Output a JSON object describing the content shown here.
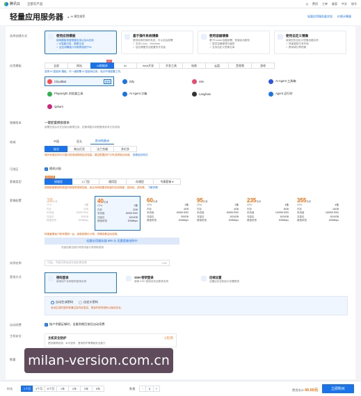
{
  "topbar": {
    "logo_text": "腾讯云",
    "nav_label": "全部云产品",
    "right_items": [
      "Q",
      "费用",
      "工单",
      "备案",
      "中文",
      "账号"
    ]
  },
  "header": {
    "title": "轻量应用服务器",
    "tag_label": "AI 模型推荐",
    "right_links": [
      "轻量应用服务器文档",
      "价格计算器"
    ]
  },
  "scenario": {
    "label": "选择创建方式",
    "cards": [
      {
        "title": "使用应用模板",
        "desc": [
          "使用模板快速搭建应用以及AI应用",
          "✓ AI智能问答、图像生成",
          "✓ 这应用模板计价推荐适用于AI"
        ],
        "selected": true
      },
      {
        "title": "基于操作系统镜像",
        "desc": [
          "提供纯净的操作系统，可以自由部署",
          "✓ 支持 Linux、Windows",
          "✓ 适合需要灵活配置的开发者"
        ],
        "selected": false
      },
      {
        "title": "使用容器镜像",
        "desc": [
          "基于Docker容器部署，快速启动服务",
          "✓ 提供容器管理与编排",
          "✓ 支持自定义镜像仓库"
        ],
        "selected": false
      },
      {
        "title": "使用自定义镜像",
        "desc": [
          "使用您的自定义镜像创建实例",
          "✓ 快速复制已有环境",
          "✓ 跨地域共享镜像"
        ],
        "selected": false
      }
    ]
  },
  "app_template": {
    "label": "应用模板",
    "tabs": [
      "全部",
      "网站",
      "AI智能体",
      "AI",
      "Web开发",
      "开发工具",
      "电商",
      "云盘",
      "音视频",
      "游戏"
    ],
    "active_tab": 2,
    "hot_badge": "HOT",
    "hint": "选择 AI 智能体 模板，可一键部署 AI 智能体应用，免去环境配置工作。",
    "items": [
      {
        "name": "CloudBot",
        "badge": "推荐",
        "color": "#ff4d4f"
      },
      {
        "name": "Dify",
        "badge": "",
        "color": "#1a73e8"
      },
      {
        "name": "n8n",
        "badge": "",
        "color": "#ea4b71"
      },
      {
        "name": "AI Agent 工具箱",
        "badge": "",
        "color": "#2f54eb"
      },
      {
        "name": "Playwright 浏览器工具",
        "badge": "",
        "color": "#2ab44a"
      },
      {
        "name": "AI Agent 沙箱",
        "badge": "",
        "color": "#1a73e8"
      },
      {
        "name": "Langfuse",
        "badge": "",
        "color": "#333333"
      },
      {
        "name": "Agent 运行时",
        "badge": "",
        "color": "#1a73e8"
      },
      {
        "name": "Qdrant",
        "badge": "",
        "color": "#d4237a"
      }
    ]
  },
  "os_version": {
    "label": "镜像版本",
    "value": "一键配置模板版本",
    "hint": "部署完成后可在控制台管理应用，如需调整实例配置请参考文档说明。"
  },
  "region": {
    "label": "地域",
    "tabs": [
      "中国",
      "亚太",
      "欧洲和美洲"
    ],
    "active_tab": 2,
    "sub_tabs": [
      "硅谷",
      "弗吉尼亚",
      "法兰克福",
      "多伦多"
    ],
    "active_sub": 0,
    "note": "境外地域实例与中国大陆地域网络延迟较高，建议根据用户分布选择就近地域。",
    "note_link": "查看延迟测试"
  },
  "availability": {
    "label": "可用区",
    "check_label": "随机分配"
  },
  "instance_type": {
    "label": "套餐类型",
    "tabs": [
      "锐驰型",
      "入门型",
      "通用型",
      "存储型",
      "专属套餐 ▾"
    ],
    "active_tab": 0,
    "badge": "限时特惠",
    "note": "锐驰型套餐拥有更高的网络带宽和性能，适合对网络要求较高的应用场景，如网站、游戏等。",
    "note_link": "了解详情"
  },
  "plans": {
    "label": "套餐配置",
    "unit": "元/月",
    "spec_labels": [
      "CPU",
      "内存",
      "系统盘",
      "流量包",
      "峰值带宽"
    ],
    "items": [
      {
        "price": "38",
        "specs": [
          "2核",
          "2GB",
          "50GB SSD",
          "300GB",
          "200Mbps"
        ],
        "disabled": true,
        "selected": false
      },
      {
        "price": "40",
        "specs": [
          "2核",
          "2GB",
          "50GB SSD",
          "1024GB",
          "200Mbps"
        ],
        "disabled": false,
        "selected": true
      },
      {
        "price": "60",
        "specs": [
          "2核",
          "4GB",
          "60GB SSD",
          "300GB",
          "200Mbps"
        ],
        "disabled": false,
        "selected": false
      },
      {
        "price": "95",
        "specs": [
          "2核",
          "4GB",
          "80GB SSD",
          "1024GB",
          "200Mbps"
        ],
        "disabled": false,
        "selected": false
      },
      {
        "price": "235",
        "specs": [
          "4核",
          "8GB",
          "100GB SSD",
          "1024GB",
          "200Mbps"
        ],
        "disabled": false,
        "selected": false
      },
      {
        "price": "355",
        "specs": [
          "4核",
          "16GB",
          "180GB SSD",
          "1024GB",
          "200Mbps"
        ],
        "disabled": false,
        "selected": false
      }
    ],
    "promo_note": "特惠套餐每个账号限购一台，续费按原价计算，详情查看活动说明。",
    "banner": "轻量应用服务器 999 元 优惠套餐抢购中",
    "fine_print": "流量包超出部分将按流量计费收取费用"
  },
  "instance_name": {
    "label": "实例名称",
    "placeholder": "可选，不填写将自动生成实例名称",
    "counter": "0/60"
  },
  "login": {
    "label": "登录方式",
    "cards": [
      {
        "title": "密码登录",
        "desc": "使用用户名和密码登录实例",
        "selected": true
      },
      {
        "title": "SSH 密钥登录",
        "desc": "使用 SSH 密钥对安全登录实例",
        "selected": false
      },
      {
        "title": "后续设置",
        "desc": "创建后在控制台中设置登录",
        "selected": false
      }
    ],
    "radios": [
      "自动生成密码",
      "自定义密码"
    ],
    "active_radio": 0,
    "radio_note": "自动生成的密码将通过站内信发送，请及时修改密码以保证安全。"
  },
  "auto_renew": {
    "label": "自动续费",
    "check_label": "账户余额足够时，设备到期后按月自动续费"
  },
  "security": {
    "label": "主机安全",
    "title": "主机安全防护",
    "price": "1元/月",
    "desc": "提供漏洞检测、木马查杀、登录防护等基础安全能力"
  },
  "quantity_label": "数量",
  "footer": {
    "duration_label": "时长",
    "durations": [
      "1个月",
      "3个月",
      "6个月",
      "1年",
      "2年",
      "3年",
      "5年"
    ],
    "active_duration": 0,
    "qty_label": "数量",
    "qty_value": "1",
    "price_label": "费用合计",
    "price_value": "40.00元",
    "buy_label": "立即购买"
  },
  "watermark": "milan-version.com.cn",
  "colors": {
    "accent": "#1a73e8",
    "price": "#ff6a00",
    "warn": "#e65c00"
  }
}
